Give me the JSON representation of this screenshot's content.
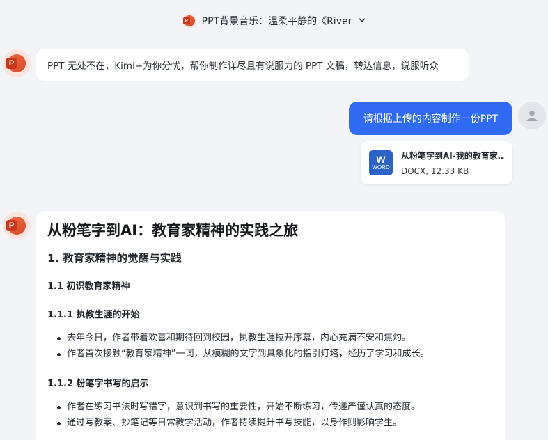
{
  "header": {
    "title": "PPT背景音乐：温柔平静的《River",
    "chevron": "⌄"
  },
  "intro_message": "PPT 无处不在，Kimi+为你分忧，帮你制作详尽且有说服力的 PPT 文稿，转达信息，说服听众",
  "user_message": "请根据上传的内容制作一份PPT",
  "file": {
    "icon_letter": "W",
    "icon_label": "WORD",
    "name": "从粉笔字到AI-我的教育家精神实践之旅",
    "meta": "DOCX, 12.33 KB"
  },
  "document": {
    "title": "从粉笔字到AI：教育家精神的实践之旅",
    "section1": "1. 教育家精神的觉醒与实践",
    "section1_1": "1.1 初识教育家精神",
    "section1_1_1": {
      "heading": "1.1.1 执教生涯的开始",
      "bullets": [
        "去年今日，作者带着欢喜和期待回到校园，执教生涯拉开序幕，内心充满不安和焦灼。",
        "作者首次接触“教育家精神”一词，从模糊的文字到具象化的指引灯塔，经历了学习和成长。"
      ]
    },
    "section1_1_2": {
      "heading": "1.1.2 粉笔字书写的启示",
      "bullets": [
        "作者在练习书法时写错字，意识到书写的重要性，开始不断练习，传递严谨认真的态度。",
        "通过写教案、抄笔记等日常教学活动，作者持续提升书写技能，以身作则影响学生。"
      ]
    }
  },
  "colors": {
    "accent": "#2f6bf2",
    "ppt_orange": "#e85a35",
    "word_blue": "#2c63c7"
  }
}
